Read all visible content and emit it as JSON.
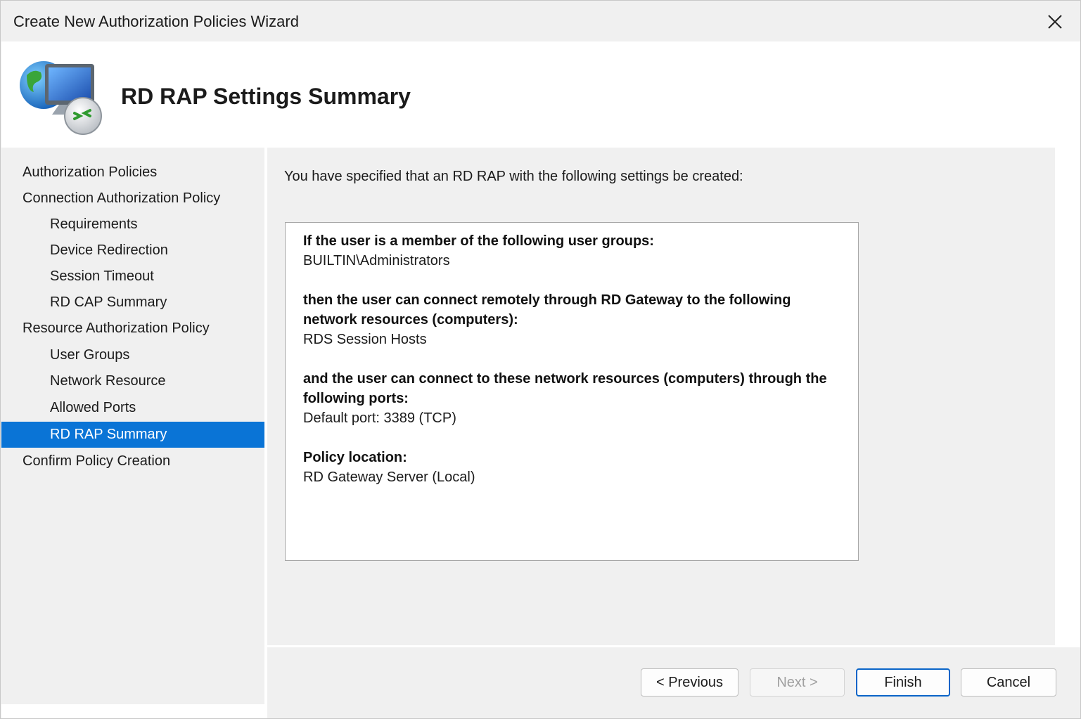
{
  "window": {
    "title": "Create New Authorization Policies Wizard"
  },
  "header": {
    "title": "RD RAP Settings Summary",
    "icon": "remote-desktop-gateway-icon"
  },
  "sidebar": {
    "items": [
      {
        "label": "Authorization Policies",
        "level": 1,
        "active": false
      },
      {
        "label": "Connection Authorization Policy",
        "level": 1,
        "active": false
      },
      {
        "label": "Requirements",
        "level": 2,
        "active": false
      },
      {
        "label": "Device Redirection",
        "level": 2,
        "active": false
      },
      {
        "label": "Session Timeout",
        "level": 2,
        "active": false
      },
      {
        "label": "RD CAP Summary",
        "level": 2,
        "active": false
      },
      {
        "label": "Resource Authorization Policy",
        "level": 1,
        "active": false
      },
      {
        "label": "User Groups",
        "level": 2,
        "active": false
      },
      {
        "label": "Network Resource",
        "level": 2,
        "active": false
      },
      {
        "label": "Allowed Ports",
        "level": 2,
        "active": false
      },
      {
        "label": "RD RAP Summary",
        "level": 2,
        "active": true
      },
      {
        "label": "Confirm Policy Creation",
        "level": 1,
        "active": false
      }
    ]
  },
  "main": {
    "intro": "You have specified that an RD RAP with the following settings be created:",
    "summary": {
      "groups_heading": "If the user is a member of the following user groups:",
      "groups_value": "BUILTIN\\Administrators",
      "resources_heading": "then the user can connect remotely through RD Gateway to the following network resources (computers):",
      "resources_value": "RDS Session Hosts",
      "ports_heading": "and the user can connect to these network resources (computers) through the following ports:",
      "ports_value": "Default port: 3389 (TCP)",
      "location_heading": "Policy location:",
      "location_value": "RD Gateway Server (Local)"
    }
  },
  "footer": {
    "previous_label": "< Previous",
    "next_label": "Next >",
    "finish_label": "Finish",
    "cancel_label": "Cancel"
  },
  "colors": {
    "accent": "#0a74d6",
    "window_bg": "#f0f0f0"
  }
}
